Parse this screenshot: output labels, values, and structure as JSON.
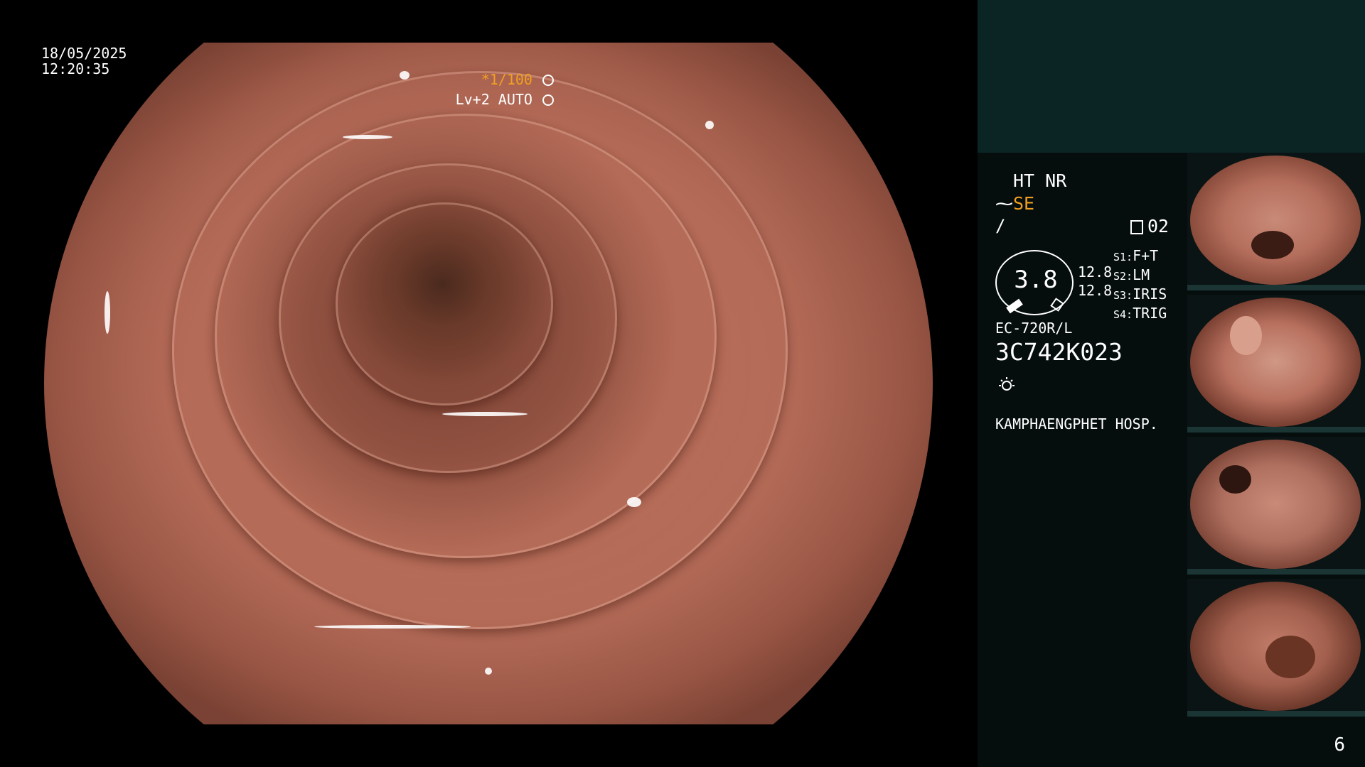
{
  "overlay": {
    "date": "18/05/2025",
    "time": "12:20:35",
    "shutter": "*1/100",
    "level_mode": "Lv+2 AUTO"
  },
  "panel": {
    "ht_nr": "HT NR",
    "se_label": "SE",
    "memory_label": "02",
    "gauge_value": "3.8",
    "gauge_nums": [
      "12.8",
      "12.8"
    ],
    "switches": [
      {
        "key": "S1:",
        "value": "F+T"
      },
      {
        "key": "S2:",
        "value": "LM"
      },
      {
        "key": "S3:",
        "value": "IRIS"
      },
      {
        "key": "S4:",
        "value": "TRIG"
      }
    ],
    "model": "EC-720R/L",
    "serial": "3C742K023",
    "hospital": "KAMPHAENGPHET HOSP."
  },
  "page_number": "6",
  "icons": [
    "shutter-icon",
    "auto-iris-icon",
    "se-icon",
    "wave-icon",
    "memory-icon",
    "light-icon"
  ],
  "colors": {
    "accent": "#f0a020",
    "panel_bg": "#050d0d",
    "panel_top": "#0b2424"
  }
}
